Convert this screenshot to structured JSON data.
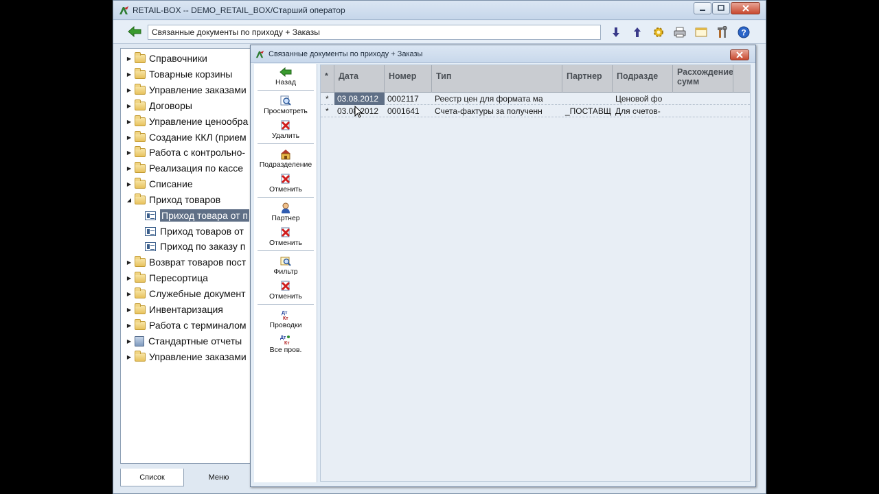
{
  "window": {
    "title": "RETAIL-BOX -- DEMO_RETAIL_BOX/Старший оператор"
  },
  "toolbar": {
    "address": "Связанные документы по приходу + Заказы",
    "icons": [
      "arrow-down-icon",
      "arrow-up-icon",
      "gear-icon",
      "print-icon",
      "window-icon",
      "tools-icon",
      "help-icon"
    ]
  },
  "tree": {
    "items": [
      {
        "label": "Справочники",
        "type": "folder"
      },
      {
        "label": "Товарные корзины",
        "type": "folder"
      },
      {
        "label": "Управление заказами",
        "type": "folder"
      },
      {
        "label": "Договоры",
        "type": "folder"
      },
      {
        "label": "Управление ценообра",
        "type": "folder"
      },
      {
        "label": "Создание ККЛ (прием",
        "type": "folder"
      },
      {
        "label": "Работа с контрольно-",
        "type": "folder"
      },
      {
        "label": "Реализация по кассе",
        "type": "folder"
      },
      {
        "label": "Списание",
        "type": "folder"
      },
      {
        "label": "Приход товаров",
        "type": "folder-open"
      },
      {
        "label": "Приход товара от п",
        "type": "doc",
        "selected": true
      },
      {
        "label": "Приход товаров от",
        "type": "doc"
      },
      {
        "label": "Приход по заказу п",
        "type": "doc"
      },
      {
        "label": "Возврат товаров пост",
        "type": "folder"
      },
      {
        "label": "Пересортица",
        "type": "folder"
      },
      {
        "label": "Служебные документ",
        "type": "folder"
      },
      {
        "label": "Инвентаризация",
        "type": "folder"
      },
      {
        "label": "Работа с терминалом",
        "type": "folder"
      },
      {
        "label": "Стандартные отчеты",
        "type": "report"
      },
      {
        "label": "Управление заказами",
        "type": "folder"
      }
    ]
  },
  "bottom_tabs": {
    "list": "Список",
    "menu": "Меню"
  },
  "dialog": {
    "title": "Связанные документы по приходу + Заказы",
    "actions": {
      "back": "Назад",
      "view": "Просмотреть",
      "delete": "Удалить",
      "division": "Подразделение",
      "cancel1": "Отменить",
      "partner": "Партнер",
      "cancel2": "Отменить",
      "filter": "Фильтр",
      "cancel3": "Отменить",
      "postings": "Проводки",
      "all_postings": "Все пров."
    },
    "columns": [
      "*",
      "Дата",
      "Номер",
      "Тип",
      "Партнер",
      "Подразде",
      "Расхождение сумм"
    ],
    "rows": [
      {
        "mark": "*",
        "date": "03.08.2012",
        "number": "0002117",
        "type": "Реестр цен для формата ма",
        "partner": "",
        "division": "Ценовой фо"
      },
      {
        "mark": "*",
        "date": "03.08.2012",
        "number": "0001641",
        "type": "Счета-фактуры за полученн",
        "partner": "_ПОСТАВЩ",
        "division": "Для счетов-"
      }
    ]
  }
}
